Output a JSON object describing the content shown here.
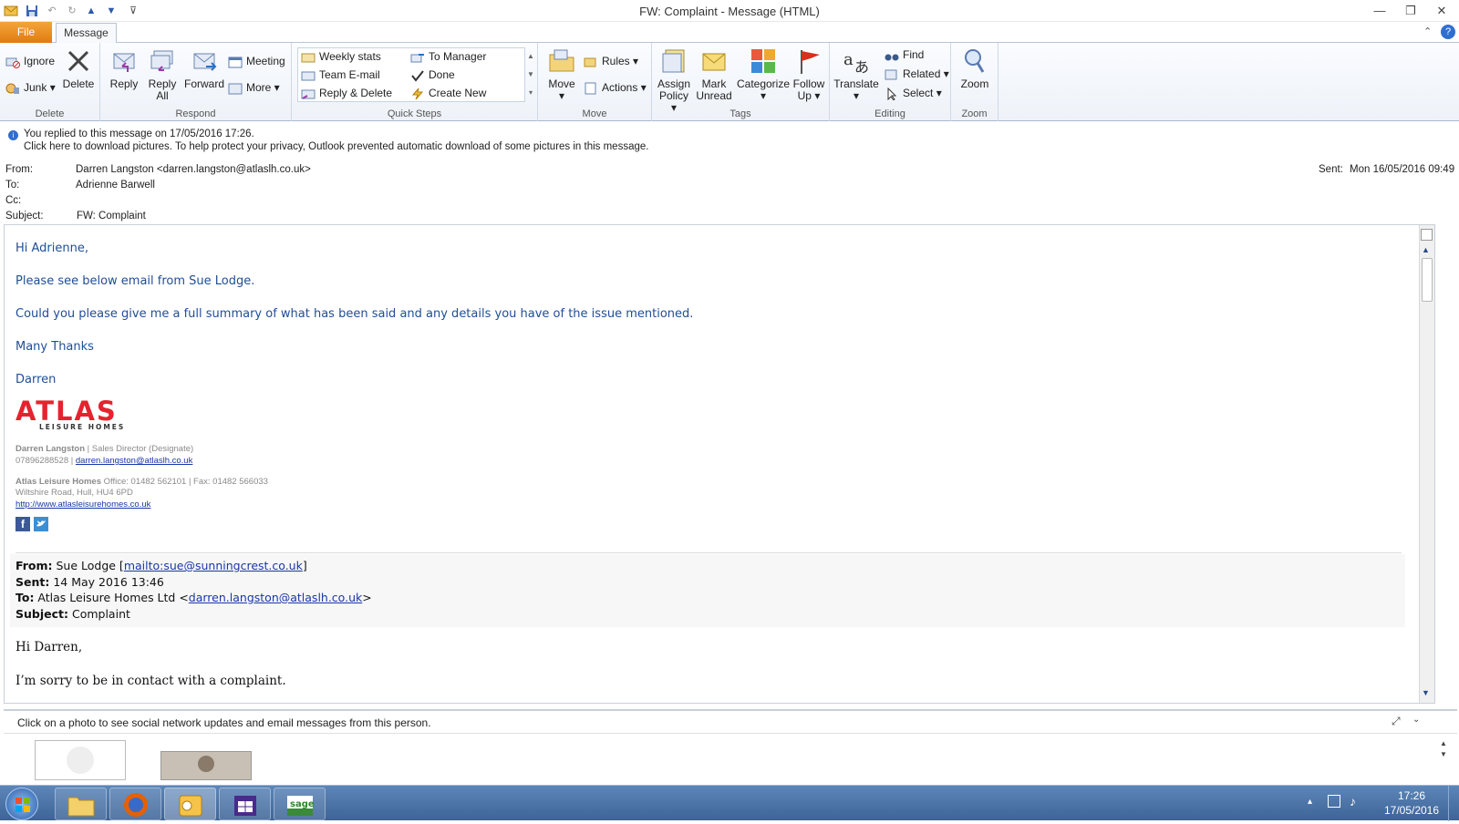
{
  "window": {
    "title": "FW: Complaint  -  Message (HTML)"
  },
  "tabs": {
    "file": "File",
    "message": "Message"
  },
  "ribbon": {
    "delete": {
      "label": "Delete",
      "ignore": "Ignore",
      "junk": "Junk",
      "delete": "Delete"
    },
    "respond": {
      "label": "Respond",
      "reply": "Reply",
      "reply_all_1": "Reply",
      "reply_all_2": "All",
      "forward": "Forward",
      "meeting": "Meeting",
      "more": "More"
    },
    "quick_steps": {
      "label": "Quick Steps",
      "items": [
        "Weekly stats",
        "Team E-mail",
        "Reply & Delete",
        "To Manager",
        "Done",
        "Create New"
      ]
    },
    "move": {
      "label": "Move",
      "move": "Move",
      "rules": "Rules",
      "actions": "Actions"
    },
    "tags": {
      "label": "Tags",
      "assign_1": "Assign",
      "assign_2": "Policy",
      "mark_1": "Mark",
      "mark_2": "Unread",
      "categorize": "Categorize",
      "follow_1": "Follow",
      "follow_2": "Up"
    },
    "editing": {
      "label": "Editing",
      "translate": "Translate",
      "find": "Find",
      "related": "Related",
      "select": "Select"
    },
    "zoom": {
      "label": "Zoom",
      "zoom": "Zoom"
    }
  },
  "info": {
    "replied": "You replied to this message on 17/05/2016 17:26.",
    "pictures": "Click here to download pictures. To help protect your privacy, Outlook prevented automatic download of some pictures in this message.",
    "from_label": "From:",
    "from": "Darren Langston <darren.langston@atlaslh.co.uk>",
    "to_label": "To:",
    "to": "Adrienne Barwell",
    "cc_label": "Cc:",
    "subject_label": "Subject:",
    "subject": "FW: Complaint",
    "sent_label": "Sent:",
    "sent": "Mon 16/05/2016 09:49"
  },
  "email": {
    "greeting": "Hi Adrienne,",
    "line1": "Please see below email from Sue Lodge.",
    "line2": "Could you please give me a full summary of what has been said and any details you have of the issue mentioned.",
    "thanks": "Many Thanks",
    "name": "Darren",
    "logo_text": "ATLAS",
    "logo_sub": "LEISURE HOMES",
    "sig_name": "Darren Langston",
    "sig_role": " | Sales Director (Designate)",
    "sig_phone": "07896288528 | ",
    "sig_email": "darren.langston@atlaslh.co.uk",
    "sig_company": "Atlas Leisure Homes",
    "sig_office": " Office: 01482 562101 | Fax: 01482 566033",
    "sig_address": "Wiltshire Road, Hull, HU4 6PD",
    "sig_web": "http://www.atlasleisurehomes.co.uk",
    "fwd_from_label": "From:",
    "fwd_from": " Sue Lodge [",
    "fwd_from_link": "mailto:sue@sunningcrest.co.uk",
    "fwd_from_end": "]",
    "fwd_sent_label": "Sent:",
    "fwd_sent": " 14 May 2016 13:46",
    "fwd_to_label": "To:",
    "fwd_to": " Atlas Leisure Homes Ltd <",
    "fwd_to_link": "darren.langston@atlaslh.co.uk",
    "fwd_to_end": ">",
    "fwd_subject_label": "Subject:",
    "fwd_subject": " Complaint",
    "fwd_greeting": "Hi Darren,",
    "fwd_line1": "I’m sorry to be in contact with a complaint."
  },
  "people_pane": {
    "text": "Click on a photo to see social network updates and email messages from this person."
  },
  "taskbar": {
    "time": "17:26",
    "date": "17/05/2016"
  }
}
